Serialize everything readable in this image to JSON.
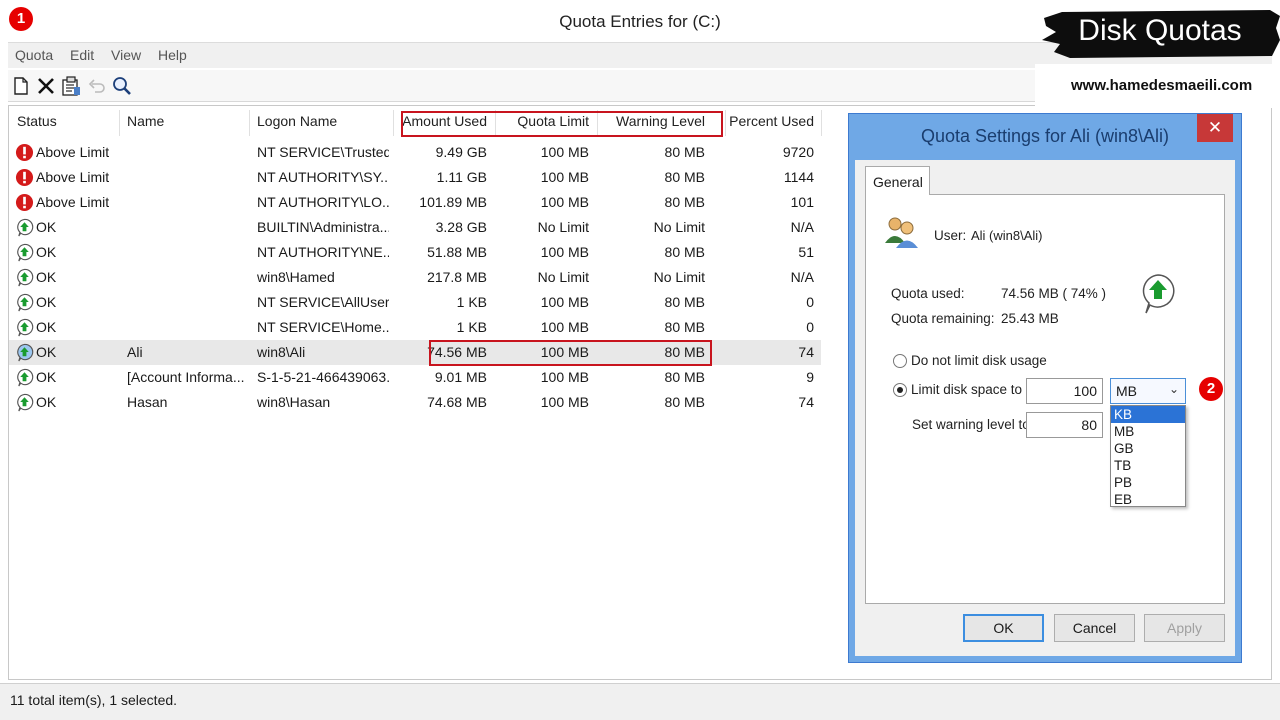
{
  "window": {
    "title": "Quota Entries for  (C:)"
  },
  "badges": {
    "one": "1",
    "two": "2"
  },
  "menu": [
    "Quota",
    "Edit",
    "View",
    "Help"
  ],
  "toolbar": [
    "new-entry-icon",
    "delete-icon",
    "properties-icon",
    "undo-icon",
    "find-icon"
  ],
  "columns": {
    "status": "Status",
    "name": "Name",
    "logon": "Logon Name",
    "amount": "Amount Used",
    "limit": "Quota Limit",
    "warning": "Warning Level",
    "percent": "Percent Used"
  },
  "rows": [
    {
      "status": "Above Limit",
      "icon": "error-icon",
      "name": "",
      "logon": "NT SERVICE\\Trusted...",
      "amount": "9.49 GB",
      "limit": "100 MB",
      "warning": "80 MB",
      "percent": "9720"
    },
    {
      "status": "Above Limit",
      "icon": "error-icon",
      "name": "",
      "logon": "NT AUTHORITY\\SY...",
      "amount": "1.11 GB",
      "limit": "100 MB",
      "warning": "80 MB",
      "percent": "1144"
    },
    {
      "status": "Above Limit",
      "icon": "error-icon",
      "name": "",
      "logon": "NT AUTHORITY\\LO...",
      "amount": "101.89 MB",
      "limit": "100 MB",
      "warning": "80 MB",
      "percent": "101"
    },
    {
      "status": "OK",
      "icon": "ok-icon",
      "name": "",
      "logon": "BUILTIN\\Administra...",
      "amount": "3.28 GB",
      "limit": "No Limit",
      "warning": "No Limit",
      "percent": "N/A"
    },
    {
      "status": "OK",
      "icon": "ok-icon",
      "name": "",
      "logon": "NT AUTHORITY\\NE...",
      "amount": "51.88 MB",
      "limit": "100 MB",
      "warning": "80 MB",
      "percent": "51"
    },
    {
      "status": "OK",
      "icon": "ok-icon",
      "name": "",
      "logon": "win8\\Hamed",
      "amount": "217.8 MB",
      "limit": "No Limit",
      "warning": "No Limit",
      "percent": "N/A"
    },
    {
      "status": "OK",
      "icon": "ok-icon",
      "name": "",
      "logon": "NT SERVICE\\AllUserI...",
      "amount": "1 KB",
      "limit": "100 MB",
      "warning": "80 MB",
      "percent": "0"
    },
    {
      "status": "OK",
      "icon": "ok-icon",
      "name": "",
      "logon": "NT SERVICE\\Home...",
      "amount": "1 KB",
      "limit": "100 MB",
      "warning": "80 MB",
      "percent": "0"
    },
    {
      "status": "OK",
      "icon": "ok-icon",
      "name": "Ali",
      "logon": "win8\\Ali",
      "amount": "74.56 MB",
      "limit": "100 MB",
      "warning": "80 MB",
      "percent": "74"
    },
    {
      "status": "OK",
      "icon": "ok-icon",
      "name": "[Account Informa...",
      "logon": "S-1-5-21-466439063...",
      "amount": "9.01 MB",
      "limit": "100 MB",
      "warning": "80 MB",
      "percent": "9"
    },
    {
      "status": "OK",
      "icon": "ok-icon",
      "name": "Hasan",
      "logon": "win8\\Hasan",
      "amount": "74.68 MB",
      "limit": "100 MB",
      "warning": "80 MB",
      "percent": "74"
    }
  ],
  "statusbar": {
    "text": "11 total item(s), 1 selected."
  },
  "brand": {
    "title": "Disk Quotas",
    "url": "www.hamedesmaeili.com"
  },
  "dialog": {
    "title": "Quota Settings for Ali (win8\\Ali)",
    "close": "✕",
    "tab": "General",
    "user_label": "User:",
    "user_value": "Ali (win8\\Ali)",
    "used_label": "Quota used:",
    "used_value": "74.56 MB ( 74% )",
    "remaining_label": "Quota remaining:",
    "remaining_value": "25.43 MB",
    "no_limit_label": "Do not limit disk usage",
    "limit_label": "Limit disk space to",
    "limit_value": "100",
    "limit_unit": "MB",
    "warning_label": "Set warning level to",
    "warning_value": "80",
    "units": [
      "KB",
      "MB",
      "GB",
      "TB",
      "PB",
      "EB"
    ],
    "ok": "OK",
    "cancel": "Cancel",
    "apply": "Apply"
  },
  "colors": {
    "accent_red": "#c8141e",
    "dialog_frame": "#6fa8e6",
    "ok_green": "#1a9b2f"
  }
}
